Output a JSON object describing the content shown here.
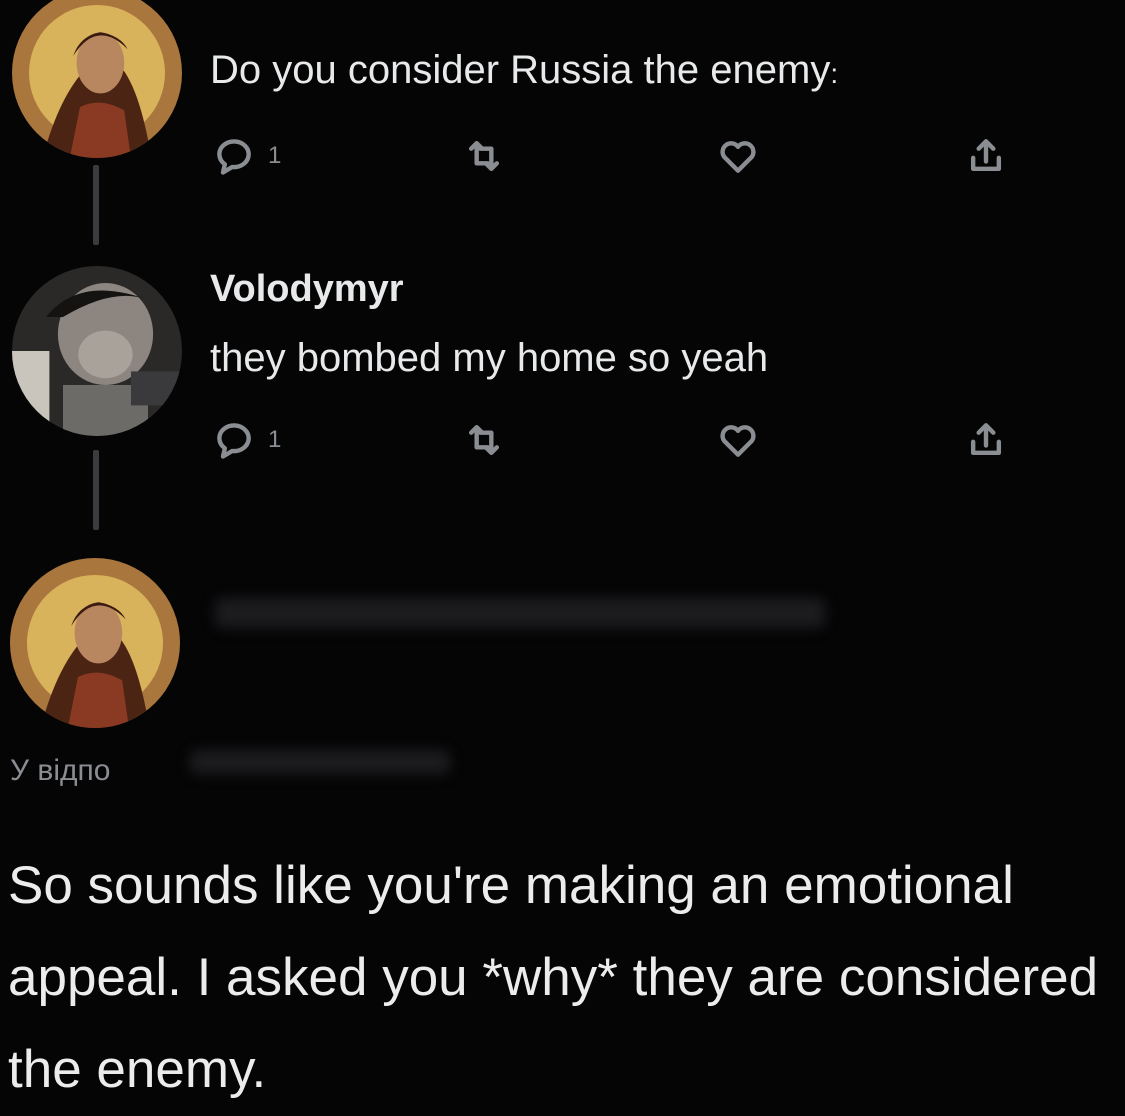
{
  "tweets": [
    {
      "text": "Do you consider Russia the enemy",
      "text_suffix": ":",
      "reply_count": "1",
      "avatar": "icon-painting-avatar"
    },
    {
      "author": "Volodymyr",
      "text": "they bombed my home so yeah",
      "reply_count": "1",
      "avatar": "selfie-avatar"
    }
  ],
  "reply": {
    "avatar": "icon-painting-avatar",
    "replying_to_prefix": "У відпо",
    "text": "So sounds like you're making an emotional appeal. I asked you *why* they are considered the enemy."
  },
  "icons": {
    "reply": "speech-bubble-icon",
    "retweet": "retweet-icon",
    "like": "heart-icon",
    "share": "share-icon"
  },
  "colors": {
    "background": "#050506",
    "text": "#e7e9ea",
    "muted": "#8a8d91",
    "thread_line": "#3a3b3e"
  }
}
